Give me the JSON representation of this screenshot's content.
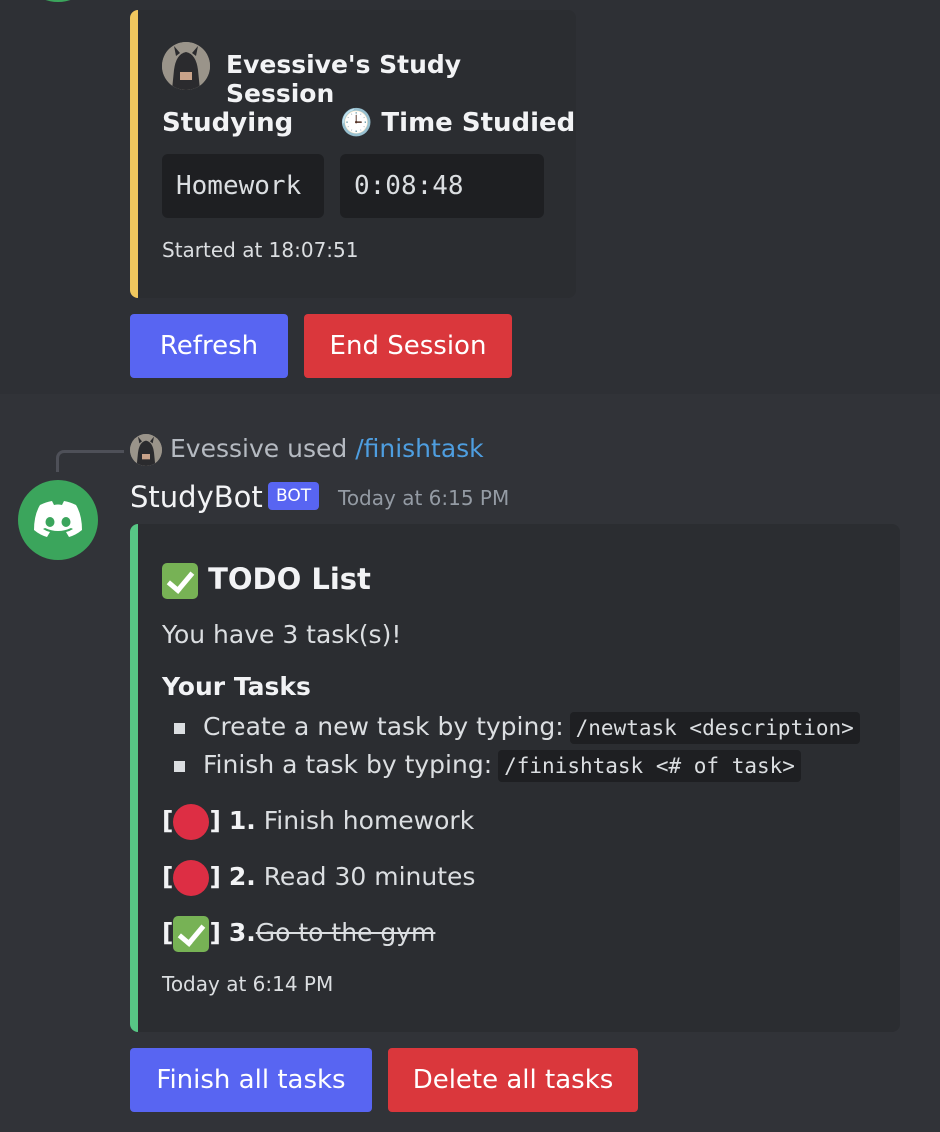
{
  "session_message": {
    "embed": {
      "author": "Evessive's Study Session",
      "fields": [
        {
          "name": "Studying",
          "value": "Homework"
        },
        {
          "name": "🕒 Time Studied",
          "value": "0:08:48"
        }
      ],
      "footer": "Started at 18:07:51",
      "accent_color": "#f0c75e"
    },
    "buttons": {
      "refresh": "Refresh",
      "end_session": "End Session"
    }
  },
  "todo_message": {
    "reply": {
      "user": "Evessive",
      "used": "used",
      "command": "/finishtask"
    },
    "author": {
      "name": "StudyBot",
      "tag": "BOT",
      "timestamp": "Today at 6:15 PM"
    },
    "embed": {
      "title": "TODO List",
      "description": "You have 3 task(s)!",
      "subheading": "Your Tasks",
      "instructions": [
        {
          "text": "Create a new task by typing:",
          "code": "/newtask <description>"
        },
        {
          "text": "Finish a task by typing:",
          "code": "/finishtask <# of task>"
        }
      ],
      "tasks": [
        {
          "number": "1.",
          "text": "Finish homework",
          "status": "pending"
        },
        {
          "number": "2.",
          "text": "Read 30 minutes",
          "status": "pending"
        },
        {
          "number": "3.",
          "text": "Go to the gym",
          "status": "done"
        }
      ],
      "footer": "Today at 6:14 PM",
      "accent_color": "#57c785"
    },
    "buttons": {
      "finish_all": "Finish all tasks",
      "delete_all": "Delete all tasks"
    }
  }
}
